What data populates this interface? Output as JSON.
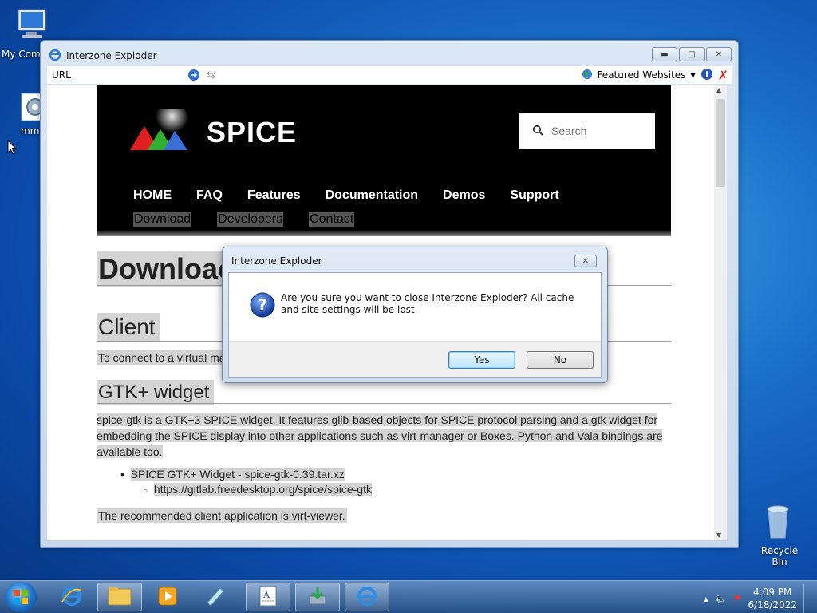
{
  "desktop": {
    "icons": [
      {
        "label": "My Comp"
      },
      {
        "label": "mm"
      },
      {
        "label": "Recycle Bin"
      }
    ]
  },
  "browser": {
    "title": "Interzone Exploder",
    "url_label": "URL",
    "url_value": "",
    "featured_label": "Featured Websites",
    "page": {
      "brand": "SPICE",
      "search_placeholder": "Search",
      "nav": [
        "HOME",
        "FAQ",
        "Features",
        "Documentation",
        "Demos",
        "Support"
      ],
      "subnav": [
        "Download",
        "Developers",
        "Contact"
      ],
      "h1": "Downloac",
      "h2_client": "Client",
      "client_text": "To connect to a virtual ma",
      "h2_gtk": "GTK+ widget",
      "gtk_para": "spice-gtk is a GTK+3 SPICE widget. It features glib-based objects for SPICE protocol parsing and a gtk widget for embedding the SPICE display into other applications such as virt-manager or Boxes. Python and Vala bindings are available too.",
      "list_item": "SPICE GTK+ Widget - spice-gtk-0.39.tar.xz",
      "list_sub": "https://gitlab.freedesktop.org/spice/spice-gtk",
      "recommended": "The recommended client application is virt-viewer."
    }
  },
  "dialog": {
    "title": "Interzone Exploder",
    "message": "Are you sure you want to close Interzone Exploder? All cache and site settings will be lost.",
    "yes": "Yes",
    "no": "No"
  },
  "taskbar": {
    "time": "4:09 PM",
    "date": "6/18/2022"
  }
}
